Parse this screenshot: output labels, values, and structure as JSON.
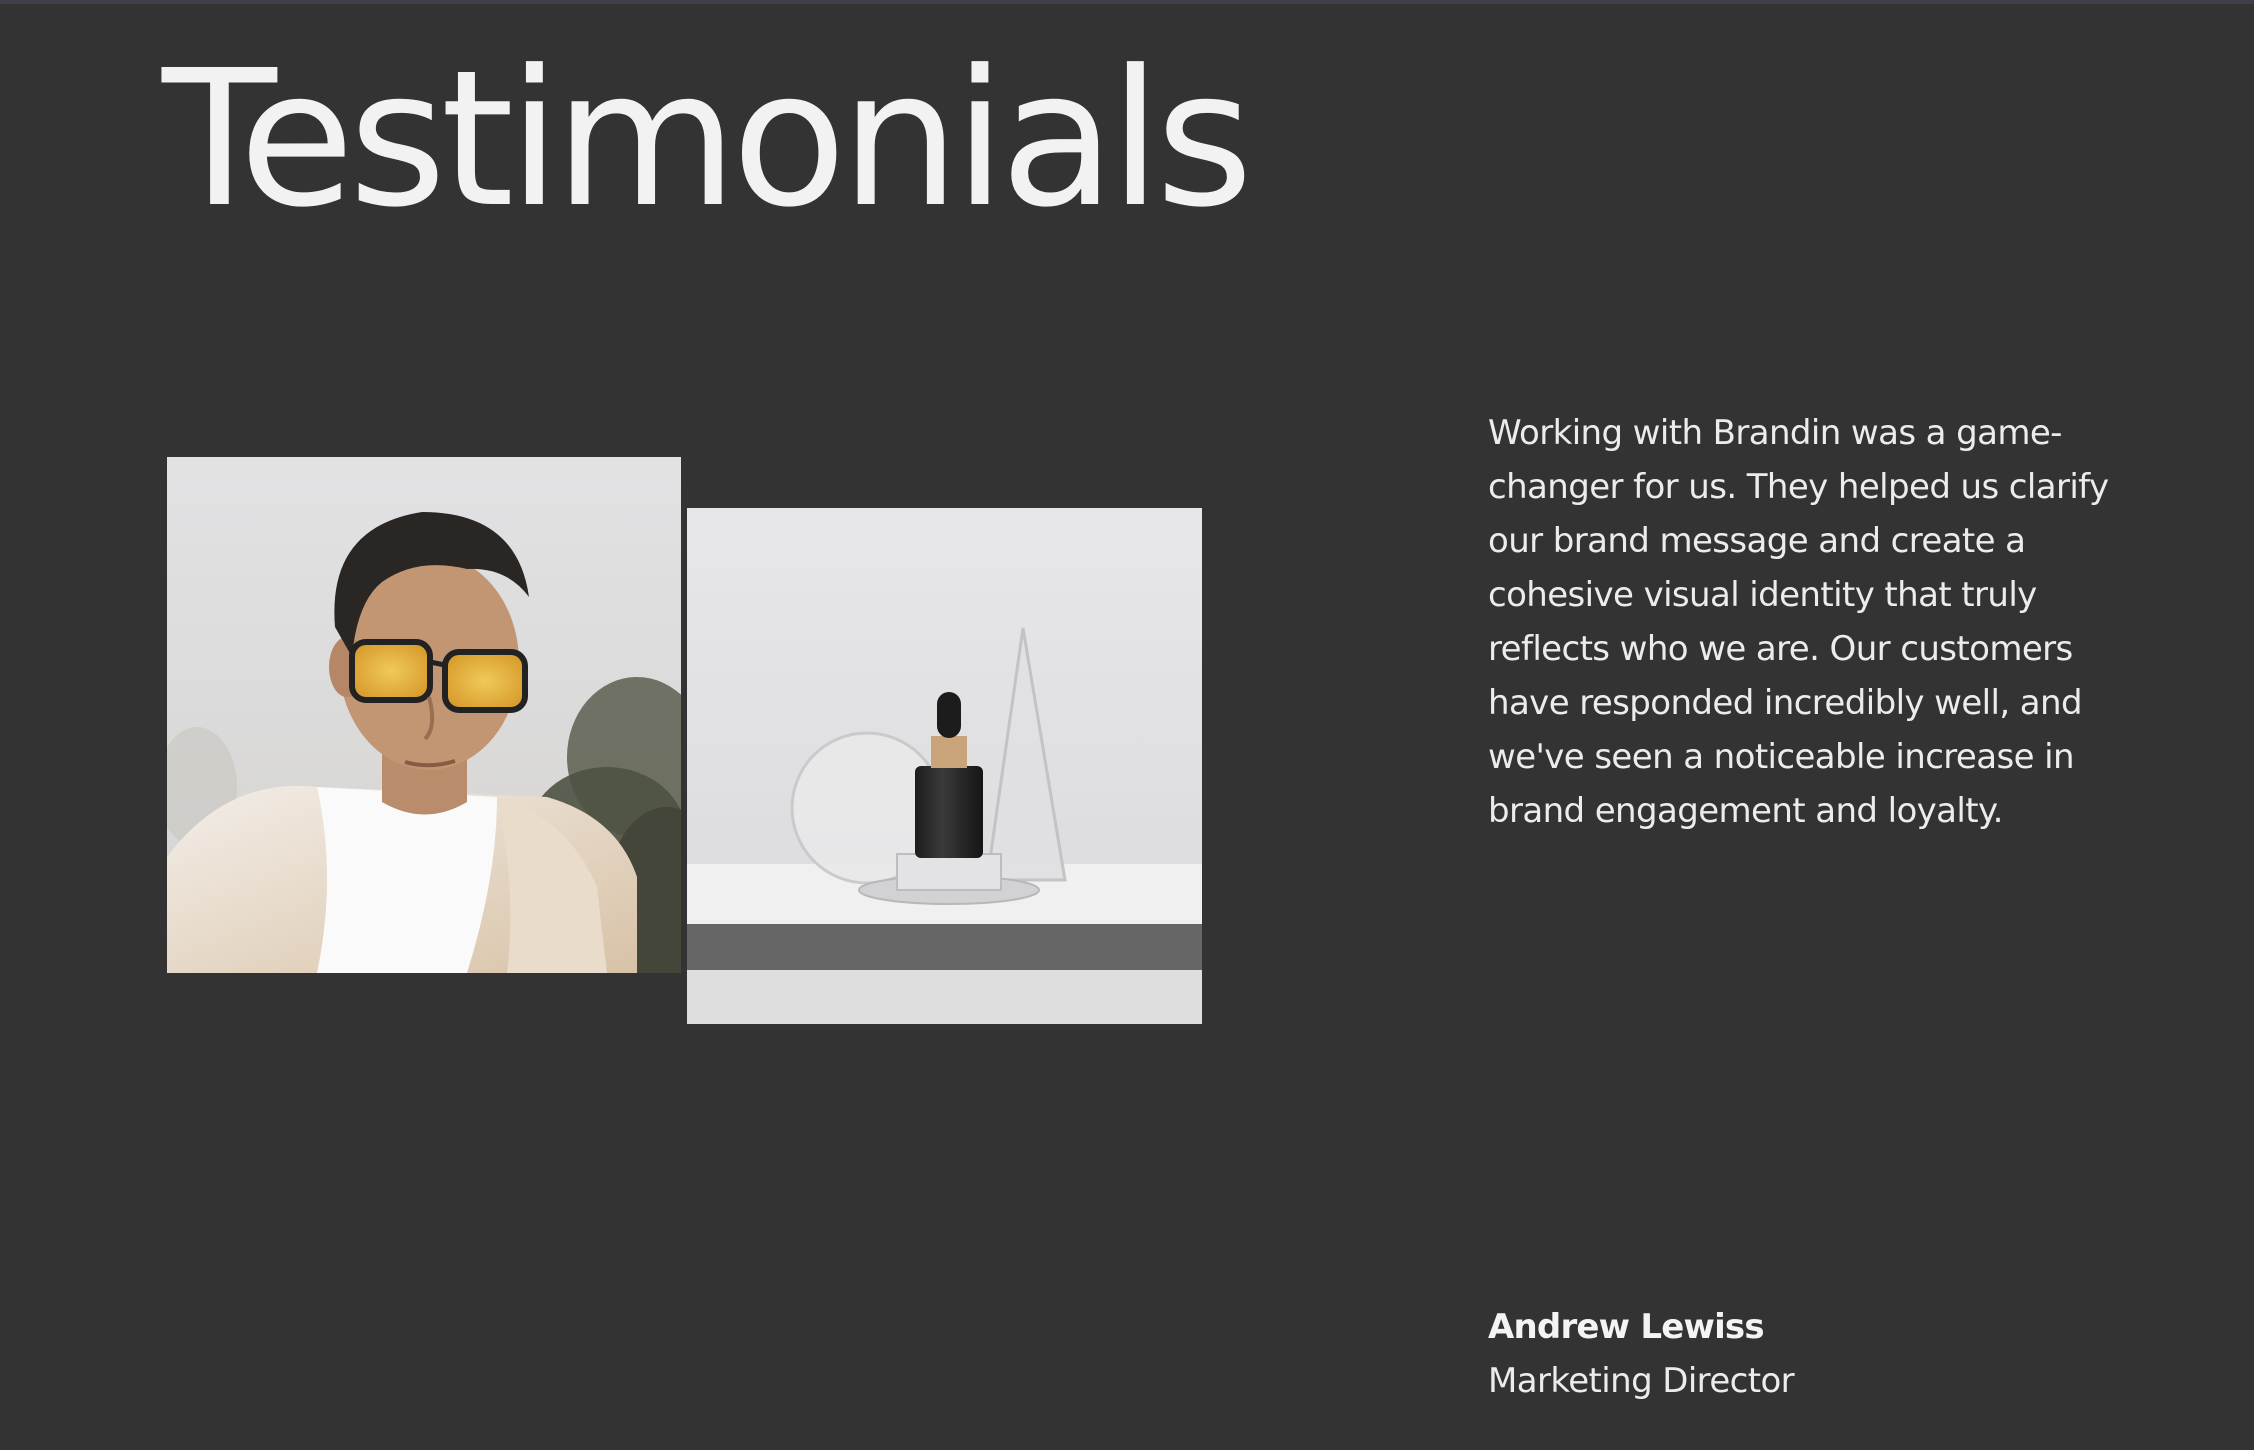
{
  "section": {
    "title": "Testimonials"
  },
  "testimonial": {
    "quote": "Working with Brandin was a game-changer for us. They helped us clarify our brand message and create a cohesive visual identity that truly reflects who we are. Our customers have responded incredibly well, and we've seen a noticeable increase in brand engagement and loyalty.",
    "author_name": "Andrew Lewiss",
    "author_role": "Marketing Director"
  },
  "images": {
    "person_photo": "portrait-photo",
    "product_photo": "dropper-bottle-photo"
  },
  "colors": {
    "background": "#333333",
    "text": "#f0f0f0",
    "top_rule": "#3f4049"
  }
}
